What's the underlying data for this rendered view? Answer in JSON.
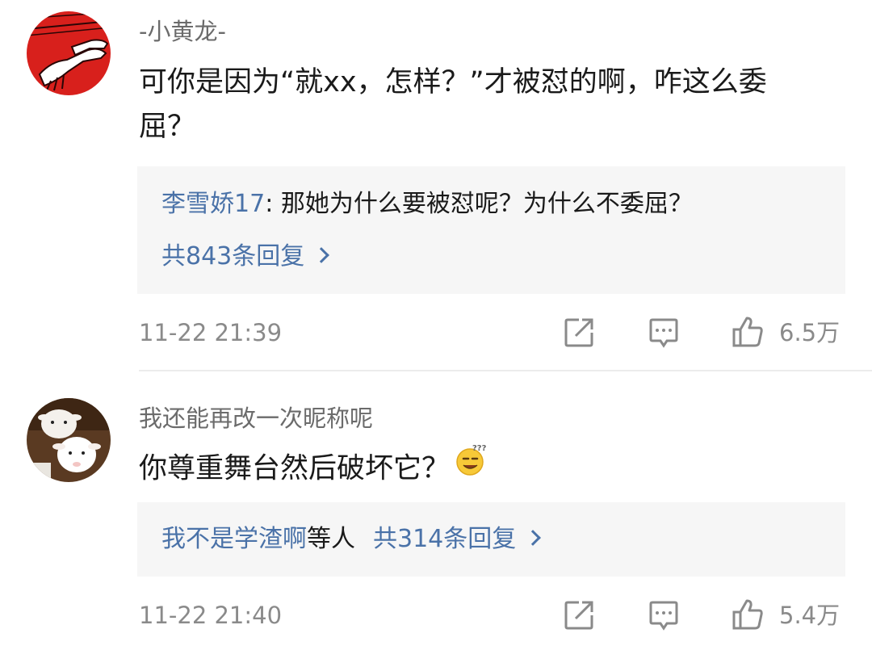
{
  "comments": [
    {
      "username": "-小黄龙-",
      "text_line1": "可你是因为“就xx，怎样？”才被怼的啊，咋这么委",
      "text_line2": "屈？",
      "reply_user": "李雪娇17",
      "reply_sep": ": ",
      "reply_text": "那她为什么要被怼呢？为什么不委屈？",
      "more_replies": "共843条回复",
      "timestamp": "11-22 21:39",
      "likes": "6.5万"
    },
    {
      "username": "我还能再改一次昵称呢",
      "text": "你尊重舞台然后破坏它？",
      "emoji": "dizzy-smile-emoji",
      "reply_users": "我不是学渣啊",
      "reply_others": "等人",
      "more_replies": "共314条回复",
      "timestamp": "11-22 21:40",
      "likes": "5.4万"
    }
  ],
  "icons": {
    "share": "share-icon",
    "comment": "comment-icon",
    "like": "thumbs-up-icon"
  },
  "colors": {
    "link_blue": "#4a72a8",
    "meta_gray": "#8a8a8a",
    "reply_bg": "#f6f6f6"
  }
}
